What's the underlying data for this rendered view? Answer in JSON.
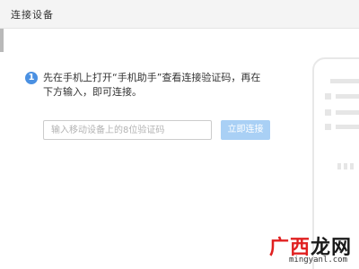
{
  "window": {
    "title": "连接设备"
  },
  "instruction": {
    "icon": "info-icon",
    "icon_glyph": "1",
    "line1": "先在手机上打开“手机助手”查看连接验证码，再在",
    "line2": "下方输入，即可连接。"
  },
  "form": {
    "code_placeholder": "输入移动设备上的8位验证码",
    "code_value": "",
    "connect_label": "立即连接"
  },
  "watermark": {
    "text_part1": "广西",
    "text_part2": "龙网",
    "domain": "mingyanl.com",
    "color1": "#e02020",
    "color2": "#1a1a1a"
  },
  "colors": {
    "accent": "#4a90e2",
    "button_disabled": "#a9d0f5",
    "titlebar_bg": "#f4f4f4"
  }
}
